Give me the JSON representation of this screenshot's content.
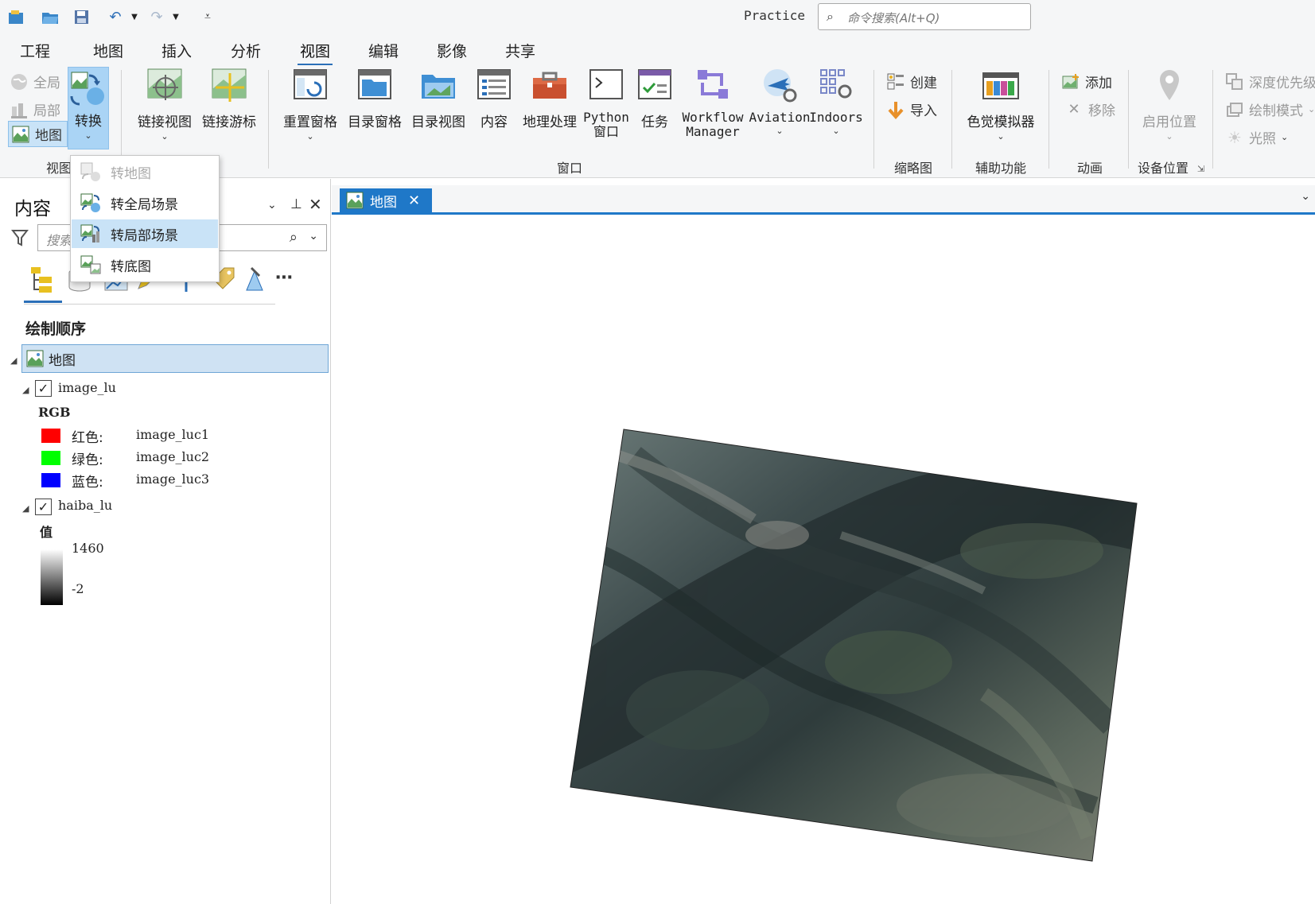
{
  "title_bar": {
    "project_name": "Practice",
    "command_search_placeholder": "命令搜索(Alt+Q)"
  },
  "ribbon_tabs": [
    "工程",
    "地图",
    "插入",
    "分析",
    "视图",
    "编辑",
    "影像",
    "共享"
  ],
  "ribbon": {
    "view_group": {
      "global": "全局",
      "local": "局部",
      "map": "地图",
      "convert": "转换",
      "label": "视图"
    },
    "link_view": "链接视图",
    "link_cursor": "链接游标",
    "window_group": {
      "reset_panes": "重置窗格",
      "catalog_pane": "目录窗格",
      "catalog_view": "目录视图",
      "contents": "内容",
      "geoprocessing": "地理处理",
      "python_line1": "Python",
      "python_line2": "窗口",
      "tasks": "任务",
      "workflow_line1": "Workflow",
      "workflow_line2": "Manager",
      "aviation": "Aviation",
      "indoors": "Indoors",
      "label": "窗口"
    },
    "thumbnail_group": {
      "create": "创建",
      "import": "导入",
      "label": "缩略图"
    },
    "accessibility_group": {
      "color_sim": "色觉模拟器",
      "label": "辅助功能"
    },
    "animation_group": {
      "add": "添加",
      "remove": "移除",
      "label": "动画"
    },
    "device_location_group": {
      "enable": "启用位置",
      "label": "设备位置"
    },
    "extra": {
      "depth_priority": "深度优先级",
      "draw_mode": "绘制模式",
      "lighting": "光照"
    }
  },
  "convert_menu": [
    {
      "label": "转地图",
      "state": "disabled"
    },
    {
      "label": "转全局场景",
      "state": "normal"
    },
    {
      "label": "转局部场景",
      "state": "highlighted"
    },
    {
      "label": "转底图",
      "state": "normal"
    }
  ],
  "contents_pane": {
    "title": "内容",
    "search_placeholder": "搜索",
    "section": "绘制顺序",
    "map_name": "地图",
    "layers": [
      {
        "name": "image_lu",
        "checked": true,
        "renderer": "RGB",
        "bands": [
          {
            "channel": "红色:",
            "band": "image_luc1",
            "color": "#ff0000"
          },
          {
            "channel": "绿色:",
            "band": "image_luc2",
            "color": "#00ff00"
          },
          {
            "channel": "蓝色:",
            "band": "image_luc3",
            "color": "#0000ff"
          }
        ]
      },
      {
        "name": "haiba_lu",
        "checked": true,
        "renderer": "值",
        "ramp_high": "1460",
        "ramp_low": "-2"
      }
    ]
  },
  "map_view": {
    "tab_label": "地图"
  },
  "colors": {
    "accent": "#1f78c8",
    "selection": "#cfe2f3",
    "menu_highlight": "#c9e3f7"
  }
}
